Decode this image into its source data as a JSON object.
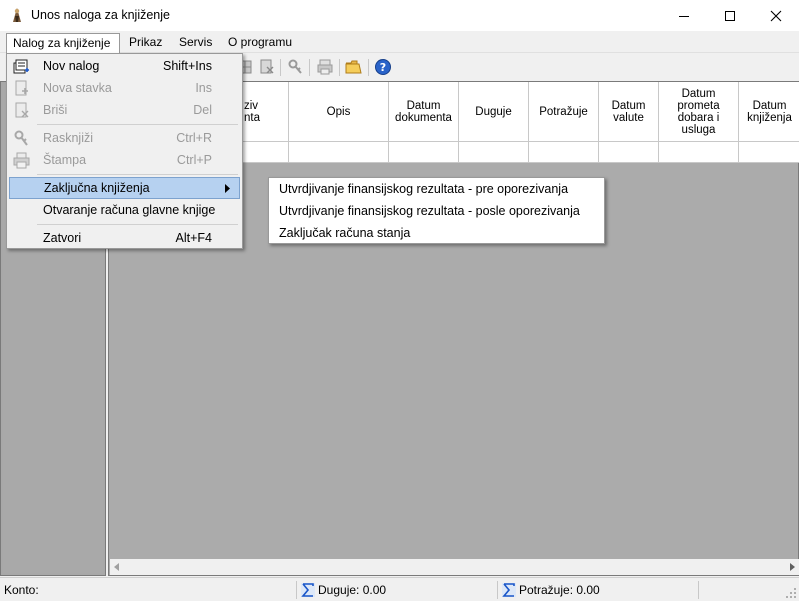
{
  "window": {
    "title": "Unos naloga za knjiženje",
    "controls": [
      "minimize-icon",
      "maximize-icon",
      "close-icon"
    ]
  },
  "menubar": {
    "items": [
      {
        "label": "Nalog za knjiženje"
      },
      {
        "label": "Prikaz"
      },
      {
        "label": "Servis"
      },
      {
        "label": "O programu"
      }
    ]
  },
  "dropdown": {
    "items": [
      {
        "label": "Nov nalog",
        "shortcut": "Shift+Ins",
        "icon": "new-document-icon",
        "enabled": true
      },
      {
        "label": "Nova stavka",
        "shortcut": "Ins",
        "icon": "add-item-icon",
        "enabled": false
      },
      {
        "label": "Briši",
        "shortcut": "Del",
        "icon": "delete-icon",
        "enabled": false
      },
      {
        "label": "Rasknjiži",
        "shortcut": "Ctrl+R",
        "icon": "key-icon",
        "enabled": false
      },
      {
        "label": "Štampa",
        "shortcut": "Ctrl+P",
        "icon": "printer-icon",
        "enabled": false
      },
      {
        "label": "Zaključna knjiženja",
        "shortcut": "",
        "enabled": true,
        "submenu": true
      },
      {
        "label": "Otvaranje računa glavne knjige",
        "shortcut": "",
        "enabled": true
      },
      {
        "label": "Zatvori",
        "shortcut": "Alt+F4",
        "enabled": true
      }
    ]
  },
  "submenu": {
    "items": [
      {
        "label": "Utvrdjivanje finansijskog rezultata - pre oporezivanja"
      },
      {
        "label": "Utvrdjivanje finansijskog rezultata - posle oporezivanja"
      },
      {
        "label": "Zaključak računa stanja"
      }
    ]
  },
  "grid": {
    "columns": [
      {
        "label": "ziv\nnta"
      },
      {
        "label": "Opis"
      },
      {
        "label": "Datum\ndokumenta"
      },
      {
        "label": "Duguje"
      },
      {
        "label": "Potražuje"
      },
      {
        "label": "Datum\nvalute"
      },
      {
        "label": "Datum\nprometa\ndobara i\nusluga"
      },
      {
        "label": "Datum\nknjiženja"
      }
    ]
  },
  "statusbar": {
    "konto_label": "Konto:",
    "duguje_label": "Duguje: 0.00",
    "potrazuje_label": "Potražuje: 0.00"
  },
  "colors": {
    "highlight": "#b6d1f0",
    "workspace": "#ababab",
    "accent_blue": "#1a56c8"
  }
}
